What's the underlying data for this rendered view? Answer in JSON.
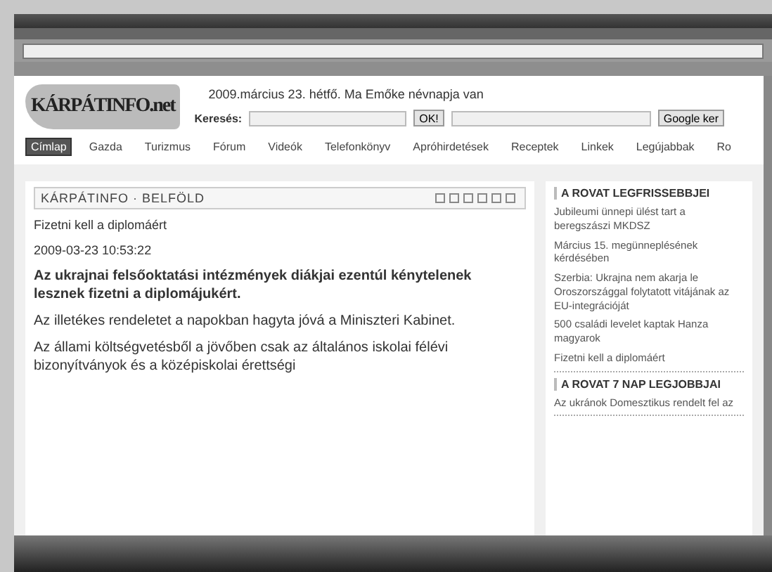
{
  "header": {
    "logo": "KÁRPÁTINFO.net",
    "date_line": "2009.március 23. hétfő. Ma Emőke névnapja van",
    "search_label": "Keresés:",
    "search_button": "OK!",
    "google_button": "Google ker"
  },
  "nav": [
    {
      "label": "Címlap",
      "selected": true
    },
    {
      "label": "Gazda",
      "selected": false
    },
    {
      "label": "Turizmus",
      "selected": false
    },
    {
      "label": "Fórum",
      "selected": false
    },
    {
      "label": "Videók",
      "selected": false
    },
    {
      "label": "Telefonkönyv",
      "selected": false
    },
    {
      "label": "Apróhirdetések",
      "selected": false
    },
    {
      "label": "Receptek",
      "selected": false
    },
    {
      "label": "Linkek",
      "selected": false
    },
    {
      "label": "Legújabbak",
      "selected": false
    },
    {
      "label": "Ro",
      "selected": false
    }
  ],
  "article": {
    "breadcrumb": "KÁRPÁTINFO · BELFÖLD",
    "title": "Fizetni kell a diplomáért",
    "timestamp": "2009-03-23 10:53:22",
    "lead": "Az ukrajnai felsőoktatási intézmények diákjai ezentúl kénytelenek lesznek fizetni a diplomájukért.",
    "paragraphs": [
      "Az illetékes rendeletet a napokban hagyta jóvá a Miniszteri Kabinet.",
      "Az állami költségvetésből a jövőben csak az általános iskolai félévi bizonyítványok és a középiskolai érettségi"
    ]
  },
  "sidebar": [
    {
      "title": "A ROVAT LEGFRISSEBBJEI",
      "items": [
        "Jubileumi ünnepi ülést tart a beregszászi MKDSZ",
        "Március 15. megünneplésének kérdésében",
        "Szerbia: Ukrajna nem akarja le Oroszországgal folytatott vitájának az EU-integrációját",
        "500 családi levelet kaptak Hanza magyarok",
        "Fizetni kell a diplomáért"
      ]
    },
    {
      "title": "A ROVAT 7 NAP LEGJOBBJAI",
      "items": [
        "Az ukránok Domesztikus rendelt fel az"
      ]
    }
  ]
}
